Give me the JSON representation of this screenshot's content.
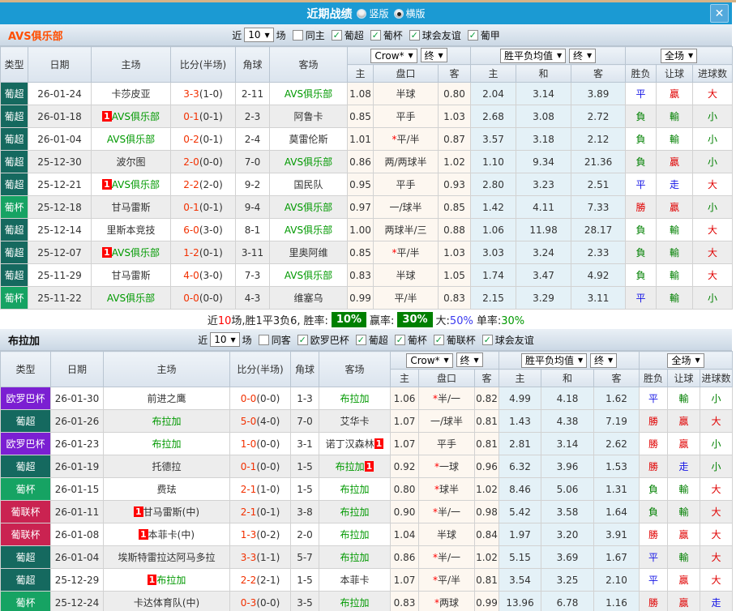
{
  "window": {
    "title": "近期战绩",
    "radio_vertical": "竖版",
    "radio_horizontal": "横版"
  },
  "table_header": {
    "type": "类型",
    "date": "日期",
    "home": "主场",
    "score": "比分(半场)",
    "corner": "角球",
    "away": "客场",
    "crow": "Crow*",
    "final": "终",
    "avg": "胜平负均值",
    "full": "全场",
    "sub_home": "主",
    "sub_handicap": "盘口",
    "sub_away": "客",
    "sub_avg_home": "主",
    "sub_avg_draw": "和",
    "sub_avg_away": "客",
    "sub_result": "胜负",
    "sub_handicap_result": "让球",
    "sub_goals": "进球数"
  },
  "colors": {
    "league": {
      "葡超": "#15695f",
      "葡杯": "#16a363",
      "欧罗巴杯": "#7b1fd2",
      "葡联杯": "#ca2351"
    },
    "team_highlight": "#009900",
    "badge": "#ff0000",
    "titlebar": "#1b9ad3"
  },
  "sections": [
    {
      "team": "AVS俱乐部",
      "filters": {
        "near_label": "近",
        "count": "10",
        "games_label": "场",
        "same_label": "同主",
        "same_checked": false,
        "leagues": [
          "葡超",
          "葡杯",
          "球会友谊",
          "葡甲"
        ]
      },
      "rows": [
        {
          "league": "葡超",
          "date": "26-01-24",
          "home": "卡莎皮亚",
          "home_badge": "",
          "home_green": false,
          "score": "3-3",
          "half": "(1-0)",
          "corner": "2-11",
          "away": "AVS俱乐部",
          "away_badge": "",
          "away_green": true,
          "odds_home": "1.08",
          "handicap_star": "",
          "handicap": "半球",
          "odds_away": "0.80",
          "avg_home": "2.04",
          "avg_draw": "3.14",
          "avg_away": "3.89",
          "result": "平",
          "bet": "贏",
          "goals": "大"
        },
        {
          "league": "葡超",
          "date": "26-01-18",
          "home": "AVS俱乐部",
          "home_badge": "1",
          "home_green": true,
          "score": "0-1",
          "half": "(0-1)",
          "corner": "2-3",
          "away": "阿鲁卡",
          "away_badge": "",
          "away_green": false,
          "odds_home": "0.85",
          "handicap_star": "",
          "handicap": "平手",
          "odds_away": "1.03",
          "avg_home": "2.68",
          "avg_draw": "3.08",
          "avg_away": "2.72",
          "result": "負",
          "bet": "輸",
          "goals": "小"
        },
        {
          "league": "葡超",
          "date": "26-01-04",
          "home": "AVS俱乐部",
          "home_badge": "",
          "home_green": true,
          "score": "0-2",
          "half": "(0-1)",
          "corner": "2-4",
          "away": "莫雷伦斯",
          "away_badge": "",
          "away_green": false,
          "odds_home": "1.01",
          "handicap_star": "*",
          "handicap": "平/半",
          "odds_away": "0.87",
          "avg_home": "3.57",
          "avg_draw": "3.18",
          "avg_away": "2.12",
          "result": "負",
          "bet": "輸",
          "goals": "小"
        },
        {
          "league": "葡超",
          "date": "25-12-30",
          "home": "波尔图",
          "home_badge": "",
          "home_green": false,
          "score": "2-0",
          "half": "(0-0)",
          "corner": "7-0",
          "away": "AVS俱乐部",
          "away_badge": "",
          "away_green": true,
          "odds_home": "0.86",
          "handicap_star": "",
          "handicap": "两/两球半",
          "odds_away": "1.02",
          "avg_home": "1.10",
          "avg_draw": "9.34",
          "avg_away": "21.36",
          "result": "負",
          "bet": "贏",
          "goals": "小"
        },
        {
          "league": "葡超",
          "date": "25-12-21",
          "home": "AVS俱乐部",
          "home_badge": "1",
          "home_green": true,
          "score": "2-2",
          "half": "(2-0)",
          "corner": "9-2",
          "away": "国民队",
          "away_badge": "",
          "away_green": false,
          "odds_home": "0.95",
          "handicap_star": "",
          "handicap": "平手",
          "odds_away": "0.93",
          "avg_home": "2.80",
          "avg_draw": "3.23",
          "avg_away": "2.51",
          "result": "平",
          "bet": "走",
          "goals": "大"
        },
        {
          "league": "葡杯",
          "date": "25-12-18",
          "home": "甘马雷斯",
          "home_badge": "",
          "home_green": false,
          "score": "0-1",
          "half": "(0-1)",
          "corner": "9-4",
          "away": "AVS俱乐部",
          "away_badge": "",
          "away_green": true,
          "odds_home": "0.97",
          "handicap_star": "",
          "handicap": "一/球半",
          "odds_away": "0.85",
          "avg_home": "1.42",
          "avg_draw": "4.11",
          "avg_away": "7.33",
          "result": "勝",
          "bet": "贏",
          "goals": "小"
        },
        {
          "league": "葡超",
          "date": "25-12-14",
          "home": "里斯本竞技",
          "home_badge": "",
          "home_green": false,
          "score": "6-0",
          "half": "(3-0)",
          "corner": "8-1",
          "away": "AVS俱乐部",
          "away_badge": "",
          "away_green": true,
          "odds_home": "1.00",
          "handicap_star": "",
          "handicap": "两球半/三",
          "odds_away": "0.88",
          "avg_home": "1.06",
          "avg_draw": "11.98",
          "avg_away": "28.17",
          "result": "負",
          "bet": "輸",
          "goals": "大"
        },
        {
          "league": "葡超",
          "date": "25-12-07",
          "home": "AVS俱乐部",
          "home_badge": "1",
          "home_green": true,
          "score": "1-2",
          "half": "(0-1)",
          "corner": "3-11",
          "away": "里奥阿维",
          "away_badge": "",
          "away_green": false,
          "odds_home": "0.85",
          "handicap_star": "*",
          "handicap": "平/半",
          "odds_away": "1.03",
          "avg_home": "3.03",
          "avg_draw": "3.24",
          "avg_away": "2.33",
          "result": "負",
          "bet": "輸",
          "goals": "大"
        },
        {
          "league": "葡超",
          "date": "25-11-29",
          "home": "甘马雷斯",
          "home_badge": "",
          "home_green": false,
          "score": "4-0",
          "half": "(3-0)",
          "corner": "7-3",
          "away": "AVS俱乐部",
          "away_badge": "",
          "away_green": true,
          "odds_home": "0.83",
          "handicap_star": "",
          "handicap": "半球",
          "odds_away": "1.05",
          "avg_home": "1.74",
          "avg_draw": "3.47",
          "avg_away": "4.92",
          "result": "負",
          "bet": "輸",
          "goals": "大"
        },
        {
          "league": "葡杯",
          "date": "25-11-22",
          "home": "AVS俱乐部",
          "home_badge": "",
          "home_green": true,
          "score": "0-0",
          "half": "(0-0)",
          "corner": "4-3",
          "away": "维塞乌",
          "away_badge": "",
          "away_green": false,
          "odds_home": "0.99",
          "handicap_star": "",
          "handicap": "平/半",
          "odds_away": "0.83",
          "avg_home": "2.15",
          "avg_draw": "3.29",
          "avg_away": "3.11",
          "result": "平",
          "bet": "輸",
          "goals": "小"
        }
      ],
      "summary": {
        "near_label": "近",
        "count": "10",
        "text": "场,胜1平3负6,",
        "rate_label": "胜率:",
        "rate": "10%",
        "win_label": "赢率:",
        "win": "30%",
        "big_label": "大:",
        "big": "50%",
        "single_label": "单率:",
        "single": "30%"
      }
    },
    {
      "team": "布拉加",
      "filters": {
        "near_label": "近",
        "count": "10",
        "games_label": "场",
        "same_label": "同客",
        "same_checked": false,
        "leagues": [
          "欧罗巴杯",
          "葡超",
          "葡杯",
          "葡联杯",
          "球会友谊"
        ]
      },
      "rows": [
        {
          "league": "欧罗巴杯",
          "date": "26-01-30",
          "home": "前进之鹰",
          "home_badge": "",
          "home_green": false,
          "score": "0-0",
          "half": "(0-0)",
          "corner": "1-3",
          "away": "布拉加",
          "away_badge": "",
          "away_green": true,
          "odds_home": "1.06",
          "handicap_star": "*",
          "handicap": "半/一",
          "odds_away": "0.82",
          "avg_home": "4.99",
          "avg_draw": "4.18",
          "avg_away": "1.62",
          "result": "平",
          "bet": "輸",
          "goals": "小"
        },
        {
          "league": "葡超",
          "date": "26-01-26",
          "home": "布拉加",
          "home_badge": "",
          "home_green": true,
          "score": "5-0",
          "half": "(4-0)",
          "corner": "7-0",
          "away": "艾华卡",
          "away_badge": "",
          "away_green": false,
          "odds_home": "1.07",
          "handicap_star": "",
          "handicap": "一/球半",
          "odds_away": "0.81",
          "avg_home": "1.43",
          "avg_draw": "4.38",
          "avg_away": "7.19",
          "result": "勝",
          "bet": "贏",
          "goals": "大"
        },
        {
          "league": "欧罗巴杯",
          "date": "26-01-23",
          "home": "布拉加",
          "home_badge": "",
          "home_green": true,
          "score": "1-0",
          "half": "(0-0)",
          "corner": "3-1",
          "away": "诺丁汉森林",
          "away_badge": "1",
          "away_green": false,
          "odds_home": "1.07",
          "handicap_star": "",
          "handicap": "平手",
          "odds_away": "0.81",
          "avg_home": "2.81",
          "avg_draw": "3.14",
          "avg_away": "2.62",
          "result": "勝",
          "bet": "贏",
          "goals": "小"
        },
        {
          "league": "葡超",
          "date": "26-01-19",
          "home": "托德拉",
          "home_badge": "",
          "home_green": false,
          "score": "0-1",
          "half": "(0-0)",
          "corner": "1-5",
          "away": "布拉加",
          "away_badge": "1",
          "away_green": true,
          "odds_home": "0.92",
          "handicap_star": "*",
          "handicap": "一球",
          "odds_away": "0.96",
          "avg_home": "6.32",
          "avg_draw": "3.96",
          "avg_away": "1.53",
          "result": "勝",
          "bet": "走",
          "goals": "小"
        },
        {
          "league": "葡杯",
          "date": "26-01-15",
          "home": "费珐",
          "home_badge": "",
          "home_green": false,
          "score": "2-1",
          "half": "(1-0)",
          "corner": "1-5",
          "away": "布拉加",
          "away_badge": "",
          "away_green": true,
          "odds_home": "0.80",
          "handicap_star": "*",
          "handicap": "球半",
          "odds_away": "1.02",
          "avg_home": "8.46",
          "avg_draw": "5.06",
          "avg_away": "1.31",
          "result": "負",
          "bet": "輸",
          "goals": "大"
        },
        {
          "league": "葡联杯",
          "date": "26-01-11",
          "home": "甘马雷斯(中)",
          "home_badge": "1",
          "home_green": false,
          "score": "2-1",
          "half": "(0-1)",
          "corner": "3-8",
          "away": "布拉加",
          "away_badge": "",
          "away_green": true,
          "odds_home": "0.90",
          "handicap_star": "*",
          "handicap": "半/一",
          "odds_away": "0.98",
          "avg_home": "5.42",
          "avg_draw": "3.58",
          "avg_away": "1.64",
          "result": "負",
          "bet": "輸",
          "goals": "大"
        },
        {
          "league": "葡联杯",
          "date": "26-01-08",
          "home": "本菲卡(中)",
          "home_badge": "1",
          "home_green": false,
          "score": "1-3",
          "half": "(0-2)",
          "corner": "2-0",
          "away": "布拉加",
          "away_badge": "",
          "away_green": true,
          "odds_home": "1.04",
          "handicap_star": "",
          "handicap": "半球",
          "odds_away": "0.84",
          "avg_home": "1.97",
          "avg_draw": "3.20",
          "avg_away": "3.91",
          "result": "勝",
          "bet": "贏",
          "goals": "大"
        },
        {
          "league": "葡超",
          "date": "26-01-04",
          "home": "埃斯特雷拉达阿马多拉",
          "home_badge": "",
          "home_green": false,
          "score": "3-3",
          "half": "(1-1)",
          "corner": "5-7",
          "away": "布拉加",
          "away_badge": "",
          "away_green": true,
          "odds_home": "0.86",
          "handicap_star": "*",
          "handicap": "半/一",
          "odds_away": "1.02",
          "avg_home": "5.15",
          "avg_draw": "3.69",
          "avg_away": "1.67",
          "result": "平",
          "bet": "輸",
          "goals": "大"
        },
        {
          "league": "葡超",
          "date": "25-12-29",
          "home": "布拉加",
          "home_badge": "1",
          "home_green": true,
          "score": "2-2",
          "half": "(2-1)",
          "corner": "1-5",
          "away": "本菲卡",
          "away_badge": "",
          "away_green": false,
          "odds_home": "1.07",
          "handicap_star": "*",
          "handicap": "平/半",
          "odds_away": "0.81",
          "avg_home": "3.54",
          "avg_draw": "3.25",
          "avg_away": "2.10",
          "result": "平",
          "bet": "贏",
          "goals": "大"
        },
        {
          "league": "葡杯",
          "date": "25-12-24",
          "home": "卡达体育队(中)",
          "home_badge": "",
          "home_green": false,
          "score": "0-3",
          "half": "(0-0)",
          "corner": "3-5",
          "away": "布拉加",
          "away_badge": "",
          "away_green": true,
          "odds_home": "0.83",
          "handicap_star": "*",
          "handicap": "两球",
          "odds_away": "0.99",
          "avg_home": "13.96",
          "avg_draw": "6.78",
          "avg_away": "1.16",
          "result": "勝",
          "bet": "贏",
          "goals": "走"
        }
      ]
    }
  ]
}
